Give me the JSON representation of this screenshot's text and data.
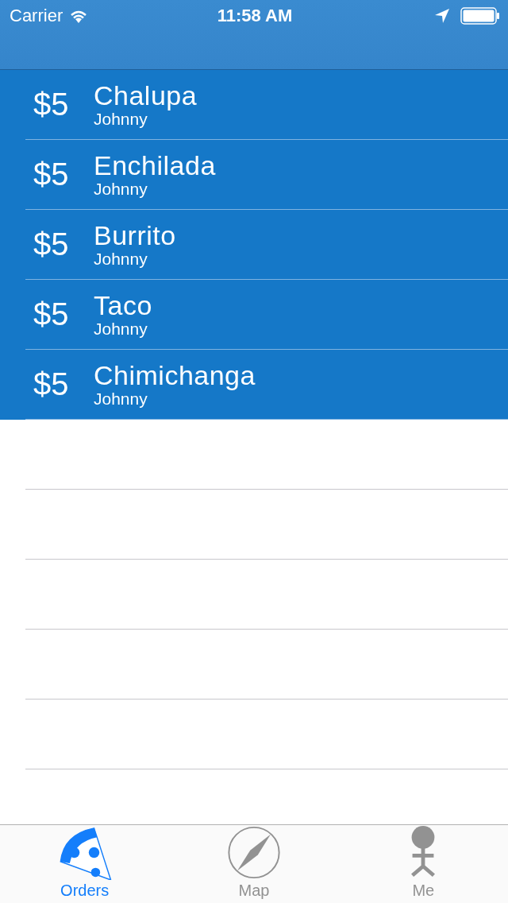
{
  "status_bar": {
    "carrier": "Carrier",
    "time": "11:58 AM"
  },
  "orders": [
    {
      "price": "$5",
      "item": "Chalupa",
      "customer": "Johnny"
    },
    {
      "price": "$5",
      "item": "Enchilada",
      "customer": "Johnny"
    },
    {
      "price": "$5",
      "item": "Burrito",
      "customer": "Johnny"
    },
    {
      "price": "$5",
      "item": "Taco",
      "customer": "Johnny"
    },
    {
      "price": "$5",
      "item": "Chimichanga",
      "customer": "Johnny"
    }
  ],
  "tabs": [
    {
      "label": "Orders",
      "kind": "pizza",
      "selected": true
    },
    {
      "label": "Map",
      "kind": "compass",
      "selected": false
    },
    {
      "label": "Me",
      "kind": "person",
      "selected": false
    }
  ]
}
